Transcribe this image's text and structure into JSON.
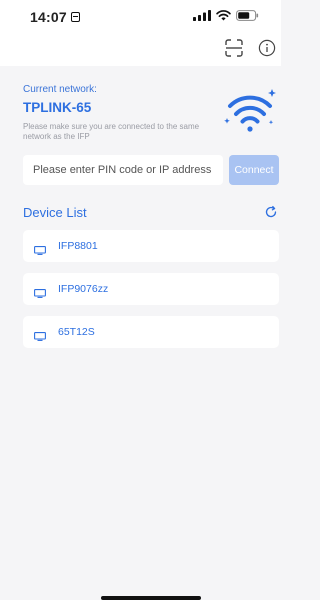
{
  "status_bar": {
    "time": "14:07",
    "signal_icon": "cellular-signal-icon",
    "wifi_icon": "wifi-icon",
    "battery_icon": "battery-icon"
  },
  "nav": {
    "scan_icon": "scan-icon",
    "info_icon": "info-icon"
  },
  "network": {
    "label": "Current network:",
    "name": "TPLINK-65",
    "hint": "Please make sure you are connected to the same network as the IFP",
    "graphic_icon": "wifi-signal-icon"
  },
  "connect": {
    "placeholder": "Please enter PIN code or IP address",
    "button_label": "Connect"
  },
  "device_list": {
    "title": "Device List",
    "refresh_icon": "refresh-icon",
    "items": [
      {
        "label": "IFP8801"
      },
      {
        "label": "IFP9076zz"
      },
      {
        "label": "65T12S"
      }
    ]
  },
  "colors": {
    "accent": "#2d6fe0",
    "connect_disabled": "#a9c3f2",
    "background": "#f5f5f7"
  }
}
